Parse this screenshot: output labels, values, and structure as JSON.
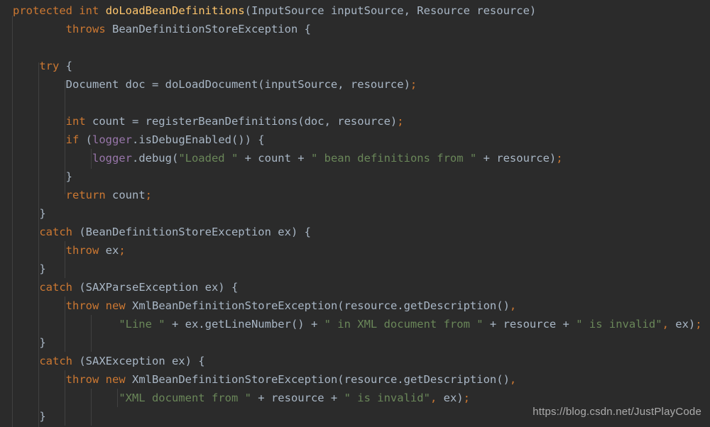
{
  "editor": {
    "language": "Java",
    "theme": "Darcula",
    "background_color": "#2b2b2b",
    "colors": {
      "keyword": "#cc7832",
      "method_declaration": "#ffc66d",
      "identifier": "#a9b7c6",
      "string": "#6a8759",
      "field": "#9876aa",
      "indent_guide": "#4a4a4a"
    },
    "indent_guides_x": [
      17,
      54,
      91,
      128,
      165,
      202,
      276
    ],
    "code_lines": [
      {
        "index": 0,
        "text": "protected int doLoadBeanDefinitions(InputSource inputSource, Resource resource)",
        "tokens": [
          {
            "t": "protected",
            "c": "kw"
          },
          {
            "t": " ",
            "c": "id"
          },
          {
            "t": "int",
            "c": "kw"
          },
          {
            "t": " ",
            "c": "id"
          },
          {
            "t": "doLoadBeanDefinitions",
            "c": "fn"
          },
          {
            "t": "(InputSource inputSource, Resource resource)",
            "c": "id"
          }
        ]
      },
      {
        "index": 1,
        "text": "        throws BeanDefinitionStoreException {",
        "tokens": [
          {
            "t": "        ",
            "c": "id"
          },
          {
            "t": "throws",
            "c": "kw"
          },
          {
            "t": " BeanDefinitionStoreException {",
            "c": "id"
          }
        ]
      },
      {
        "index": 2,
        "text": "",
        "tokens": []
      },
      {
        "index": 3,
        "text": "    try {",
        "tokens": [
          {
            "t": "    ",
            "c": "id"
          },
          {
            "t": "try",
            "c": "kw"
          },
          {
            "t": " {",
            "c": "id"
          }
        ]
      },
      {
        "index": 4,
        "text": "        Document doc = doLoadDocument(inputSource, resource);",
        "tokens": [
          {
            "t": "        Document doc = doLoadDocument(inputSource, resource)",
            "c": "id"
          },
          {
            "t": ";",
            "c": "punc"
          }
        ]
      },
      {
        "index": 5,
        "text": "",
        "tokens": []
      },
      {
        "index": 6,
        "text": "        int count = registerBeanDefinitions(doc, resource);",
        "tokens": [
          {
            "t": "        ",
            "c": "id"
          },
          {
            "t": "int",
            "c": "kw"
          },
          {
            "t": " count = registerBeanDefinitions(doc, resource)",
            "c": "id"
          },
          {
            "t": ";",
            "c": "punc"
          }
        ]
      },
      {
        "index": 7,
        "text": "        if (logger.isDebugEnabled()) {",
        "tokens": [
          {
            "t": "        ",
            "c": "id"
          },
          {
            "t": "if",
            "c": "kw"
          },
          {
            "t": " (",
            "c": "id"
          },
          {
            "t": "logger",
            "c": "fld"
          },
          {
            "t": ".isDebugEnabled()) {",
            "c": "id"
          }
        ]
      },
      {
        "index": 8,
        "text": "            logger.debug(\"Loaded \" + count + \" bean definitions from \" + resource);",
        "tokens": [
          {
            "t": "            ",
            "c": "id"
          },
          {
            "t": "logger",
            "c": "fld"
          },
          {
            "t": ".debug(",
            "c": "id"
          },
          {
            "t": "\"Loaded \"",
            "c": "str"
          },
          {
            "t": " + count + ",
            "c": "id"
          },
          {
            "t": "\" bean definitions from \"",
            "c": "str"
          },
          {
            "t": " + resource)",
            "c": "id"
          },
          {
            "t": ";",
            "c": "punc"
          }
        ]
      },
      {
        "index": 9,
        "text": "        }",
        "tokens": [
          {
            "t": "        }",
            "c": "id"
          }
        ]
      },
      {
        "index": 10,
        "text": "        return count;",
        "tokens": [
          {
            "t": "        ",
            "c": "id"
          },
          {
            "t": "return",
            "c": "kw"
          },
          {
            "t": " count",
            "c": "id"
          },
          {
            "t": ";",
            "c": "punc"
          }
        ]
      },
      {
        "index": 11,
        "text": "    }",
        "tokens": [
          {
            "t": "    }",
            "c": "id"
          }
        ]
      },
      {
        "index": 12,
        "text": "    catch (BeanDefinitionStoreException ex) {",
        "tokens": [
          {
            "t": "    ",
            "c": "id"
          },
          {
            "t": "catch",
            "c": "kw"
          },
          {
            "t": " (BeanDefinitionStoreException ex) {",
            "c": "id"
          }
        ]
      },
      {
        "index": 13,
        "text": "        throw ex;",
        "tokens": [
          {
            "t": "        ",
            "c": "id"
          },
          {
            "t": "throw",
            "c": "kw"
          },
          {
            "t": " ex",
            "c": "id"
          },
          {
            "t": ";",
            "c": "punc"
          }
        ]
      },
      {
        "index": 14,
        "text": "    }",
        "tokens": [
          {
            "t": "    }",
            "c": "id"
          }
        ]
      },
      {
        "index": 15,
        "text": "    catch (SAXParseException ex) {",
        "tokens": [
          {
            "t": "    ",
            "c": "id"
          },
          {
            "t": "catch",
            "c": "kw"
          },
          {
            "t": " (SAXParseException ex) {",
            "c": "id"
          }
        ]
      },
      {
        "index": 16,
        "text": "        throw new XmlBeanDefinitionStoreException(resource.getDescription(),",
        "tokens": [
          {
            "t": "        ",
            "c": "id"
          },
          {
            "t": "throw",
            "c": "kw"
          },
          {
            "t": " ",
            "c": "id"
          },
          {
            "t": "new",
            "c": "kw"
          },
          {
            "t": " XmlBeanDefinitionStoreException(resource.getDescription()",
            "c": "id"
          },
          {
            "t": ",",
            "c": "punc"
          }
        ]
      },
      {
        "index": 17,
        "text": "                \"Line \" + ex.getLineNumber() + \" in XML document from \" + resource + \" is invalid\", ex);",
        "tokens": [
          {
            "t": "                ",
            "c": "id"
          },
          {
            "t": "\"Line \"",
            "c": "str"
          },
          {
            "t": " + ex.getLineNumber() + ",
            "c": "id"
          },
          {
            "t": "\" in XML document from \"",
            "c": "str"
          },
          {
            "t": " + resource + ",
            "c": "id"
          },
          {
            "t": "\" is invalid\"",
            "c": "str"
          },
          {
            "t": ",",
            "c": "punc"
          },
          {
            "t": " ex)",
            "c": "id"
          },
          {
            "t": ";",
            "c": "punc"
          }
        ]
      },
      {
        "index": 18,
        "text": "    }",
        "tokens": [
          {
            "t": "    }",
            "c": "id"
          }
        ]
      },
      {
        "index": 19,
        "text": "    catch (SAXException ex) {",
        "tokens": [
          {
            "t": "    ",
            "c": "id"
          },
          {
            "t": "catch",
            "c": "kw"
          },
          {
            "t": " (SAXException ex) {",
            "c": "id"
          }
        ]
      },
      {
        "index": 20,
        "text": "        throw new XmlBeanDefinitionStoreException(resource.getDescription(),",
        "tokens": [
          {
            "t": "        ",
            "c": "id"
          },
          {
            "t": "throw",
            "c": "kw"
          },
          {
            "t": " ",
            "c": "id"
          },
          {
            "t": "new",
            "c": "kw"
          },
          {
            "t": " XmlBeanDefinitionStoreException(resource.getDescription()",
            "c": "id"
          },
          {
            "t": ",",
            "c": "punc"
          }
        ]
      },
      {
        "index": 21,
        "text": "                \"XML document from \" + resource + \" is invalid\", ex);",
        "tokens": [
          {
            "t": "                ",
            "c": "id"
          },
          {
            "t": "\"XML document from \"",
            "c": "str"
          },
          {
            "t": " + resource + ",
            "c": "id"
          },
          {
            "t": "\" is invalid\"",
            "c": "str"
          },
          {
            "t": ",",
            "c": "punc"
          },
          {
            "t": " ex)",
            "c": "id"
          },
          {
            "t": ";",
            "c": "punc"
          }
        ]
      },
      {
        "index": 22,
        "text": "    }",
        "tokens": [
          {
            "t": "    }",
            "c": "id"
          }
        ]
      }
    ]
  },
  "watermark": {
    "text": "https://blog.csdn.net/JustPlayCode"
  }
}
